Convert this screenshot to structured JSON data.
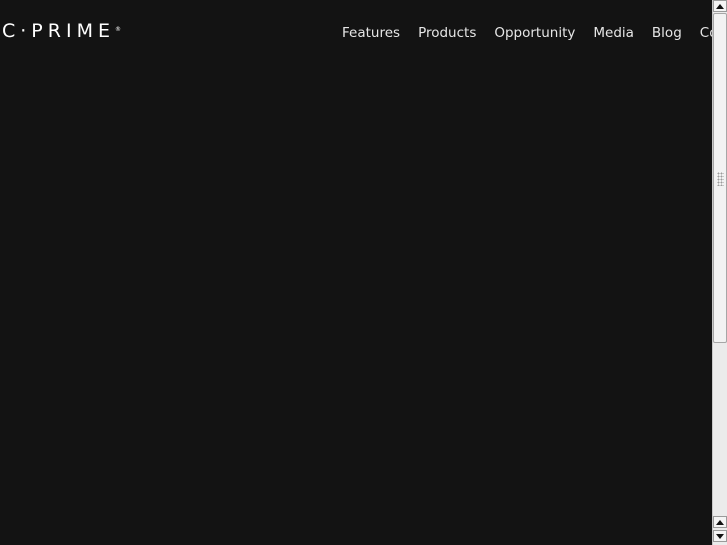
{
  "logo": {
    "text": "C·PRIME",
    "reg_mark": "®"
  },
  "nav": {
    "items": [
      {
        "label": "Features"
      },
      {
        "label": "Products"
      },
      {
        "label": "Opportunity"
      },
      {
        "label": "Media"
      },
      {
        "label": "Blog"
      },
      {
        "label": "Connect"
      }
    ]
  },
  "colors": {
    "background": "#131313",
    "nav_text": "#e6e6e6",
    "logo": "#ffffff",
    "scrollbar_track": "#ebebeb"
  },
  "icons": {
    "scroll_up": "triangle-up-icon",
    "scroll_down": "triangle-down-icon"
  }
}
